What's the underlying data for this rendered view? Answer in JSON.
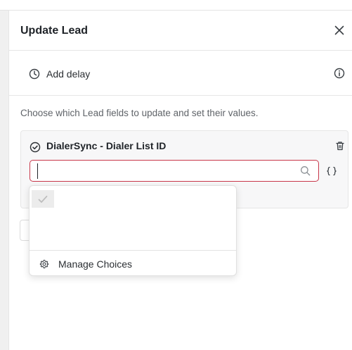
{
  "panel": {
    "title": "Update Lead",
    "close_icon": "close-icon"
  },
  "delay": {
    "label": "Add delay",
    "icon": "clock-icon",
    "info_icon": "info-icon"
  },
  "helper_text": "Choose which Lead fields to update and set their values.",
  "field": {
    "name": "DialerSync - Dialer List ID",
    "status_icon": "check-circle-icon",
    "delete_icon": "trash-icon",
    "search": {
      "value": "",
      "placeholder": "",
      "icon": "search-icon"
    },
    "variable_icon": "braces-icon"
  },
  "dropdown": {
    "options": [
      {
        "label": "",
        "selected": true
      }
    ],
    "manage_label": "Manage Choices",
    "manage_icon": "gear-icon"
  },
  "colors": {
    "focus_border": "#c8374a",
    "text_primary": "#1f2328",
    "text_secondary": "#5f6368",
    "card_background": "#f7f7f8"
  }
}
